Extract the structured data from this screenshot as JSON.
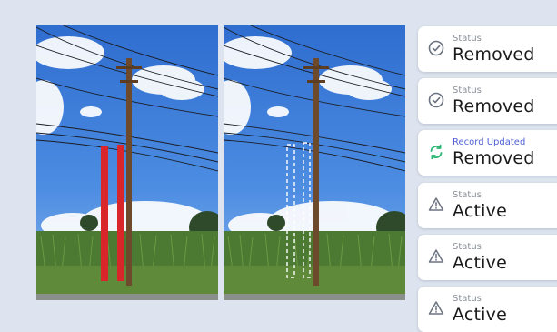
{
  "records": [
    {
      "label": "Status",
      "value": "Removed",
      "icon": "check-circle-icon",
      "color": "#6b7280"
    },
    {
      "label": "Status",
      "value": "Removed",
      "icon": "check-circle-icon",
      "color": "#6b7280"
    },
    {
      "label": "Record Updated",
      "value": "Removed",
      "icon": "sync-arrows-icon",
      "color": "#2bb673"
    },
    {
      "label": "Status",
      "value": "Active",
      "icon": "warning-triangle-icon",
      "color": "#6b7280"
    },
    {
      "label": "Status",
      "value": "Active",
      "icon": "warning-triangle-icon",
      "color": "#6b7280"
    },
    {
      "label": "Status",
      "value": "Active",
      "icon": "warning-triangle-icon",
      "color": "#6b7280"
    }
  ],
  "highlight_color": "#d8262a",
  "placeholder_outline_color": "#ffffff"
}
